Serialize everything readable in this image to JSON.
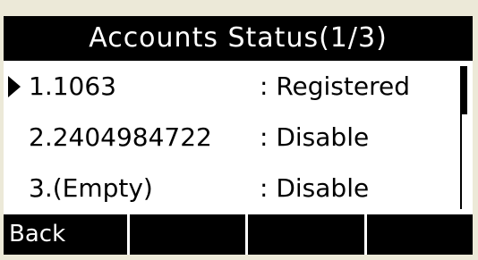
{
  "screen": {
    "title": "Accounts Status(1/3)"
  },
  "accounts": [
    {
      "name": "1.1063",
      "status": ": Registered",
      "selected": true
    },
    {
      "name": "2.2404984722",
      "status": ": Disable",
      "selected": false
    },
    {
      "name": "3.(Empty)",
      "status": ": Disable",
      "selected": false
    }
  ],
  "softkeys": [
    "Back",
    "",
    "",
    ""
  ]
}
